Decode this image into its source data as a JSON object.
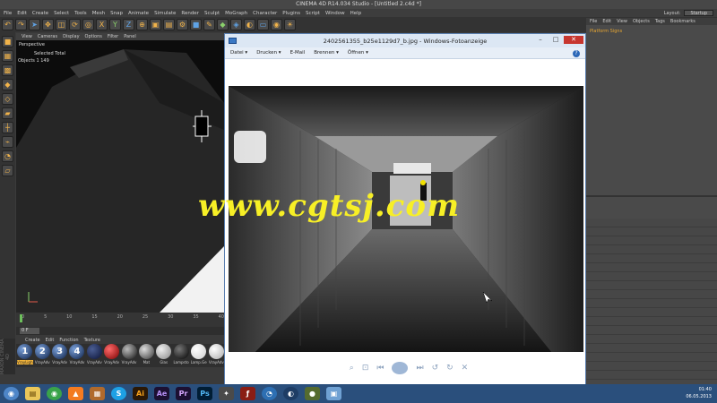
{
  "c4d": {
    "title": "CINEMA 4D R14.034 Studio - [Untitled 2.c4d *]",
    "menu": [
      "File",
      "Edit",
      "Create",
      "Select",
      "Tools",
      "Mesh",
      "Snap",
      "Animate",
      "Simulate",
      "Render",
      "Sculpt",
      "MoGraph",
      "Character",
      "Plugins",
      "Script",
      "Window",
      "Help"
    ],
    "layout_label": "Layout:",
    "layout_value": "Startup",
    "viewport_menu": [
      "View",
      "Cameras",
      "Display",
      "Options",
      "Filter",
      "Panel"
    ],
    "viewport_label": "Perspective",
    "stats_header": "Selected  Total",
    "stats_row": "Objects  1          149",
    "timeline_ticks": [
      "0",
      "5",
      "10",
      "15",
      "20",
      "25",
      "30",
      "35",
      "40"
    ],
    "frame_value": "0 F",
    "material_menu": [
      "Create",
      "Edit",
      "Function",
      "Texture"
    ],
    "materials": [
      {
        "label": "1",
        "name": "VrayLigh"
      },
      {
        "label": "2",
        "name": "VrayAdv"
      },
      {
        "label": "3",
        "name": "VrayAdv"
      },
      {
        "label": "4",
        "name": "VrayAdv"
      },
      {
        "label": "",
        "name": "VrayAdv"
      },
      {
        "label": "",
        "name": "VrayAdv"
      },
      {
        "label": "",
        "name": "VrayAdv"
      },
      {
        "label": "",
        "name": "Mat"
      },
      {
        "label": "",
        "name": "Glas"
      },
      {
        "label": "",
        "name": "Lampsto"
      },
      {
        "label": "",
        "name": "Lamp.Ge"
      },
      {
        "label": "",
        "name": "VrayAdv"
      }
    ],
    "brand": "MAXON CINEMA 4D",
    "right_menu": [
      "File",
      "Edit",
      "View",
      "Objects",
      "Tags",
      "Bookmarks"
    ],
    "object_item": "Platform Signs"
  },
  "viewer": {
    "title": "2402561355_b25e1129d7_b.jpg - Windows-Fotoanzeige",
    "menu": [
      "Datei ▾",
      "Drucken ▾",
      "E-Mail",
      "Brennen ▾",
      "Öffnen ▾"
    ],
    "help": "?",
    "min": "–",
    "max": "□",
    "close": "✕"
  },
  "watermark": "www.cgtsj.com",
  "taskbar": {
    "time": "01:40",
    "date": "06.05.2013"
  }
}
